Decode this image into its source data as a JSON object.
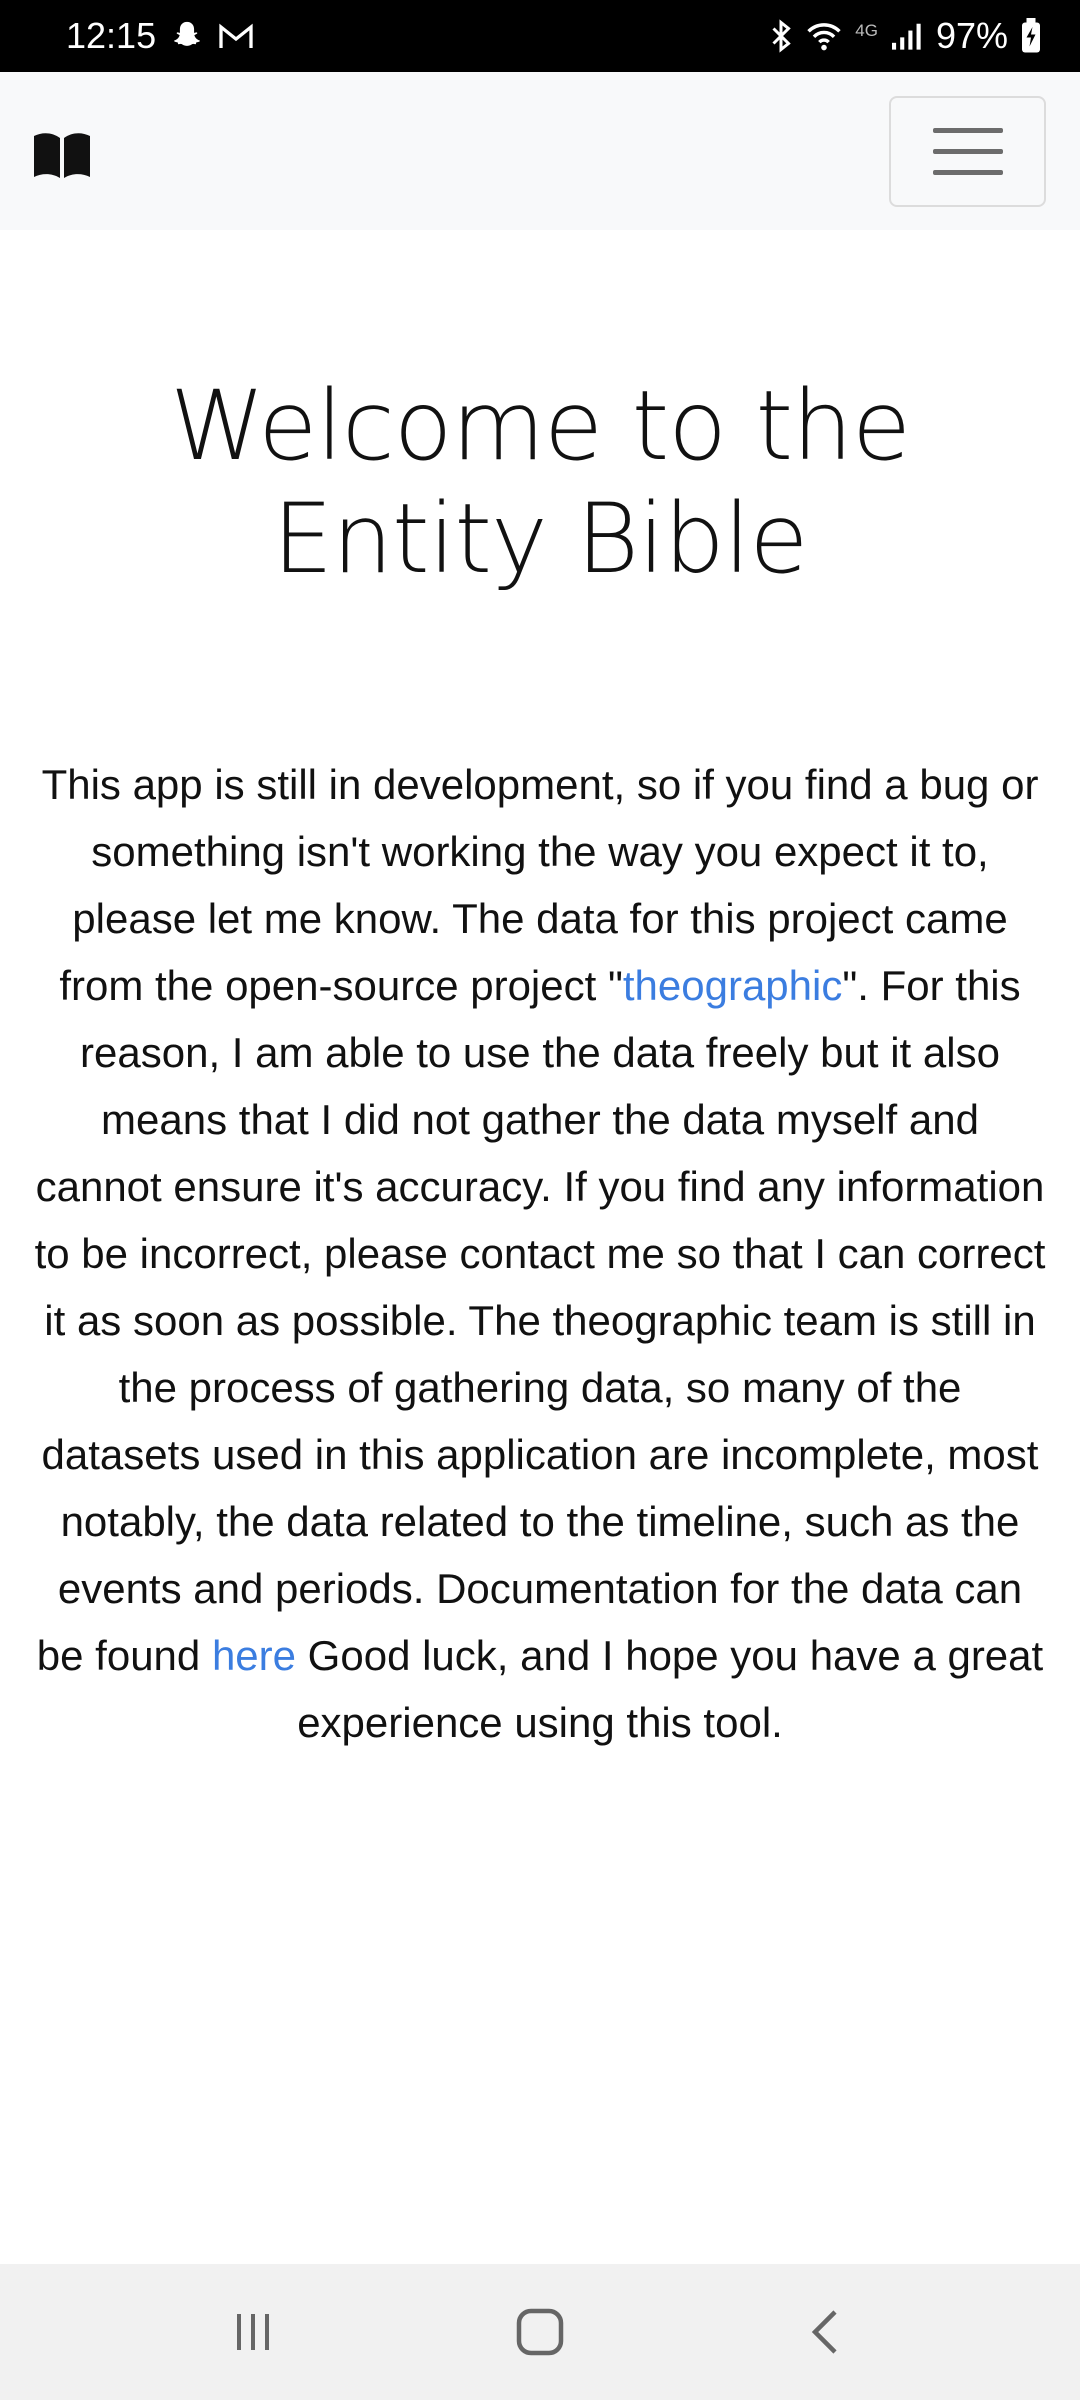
{
  "status_bar": {
    "time": "12:15",
    "battery": "97%",
    "icons": [
      "snapchat-icon",
      "gmail-icon",
      "bluetooth-icon",
      "wifi-icon",
      "lte-icon",
      "signal-icon",
      "battery-charging-icon"
    ],
    "network_label": "4G"
  },
  "navbar": {
    "brand_icon": "book-icon",
    "menu_icon": "hamburger-menu-icon"
  },
  "main": {
    "title": "Welcome to the Entity Bible",
    "intro": {
      "part1": "This app is still in development, so if you find a bug or something isn't working the way you expect it to, please let me know. The data for this project came from the open-source project \"",
      "link1": "theographic",
      "part2": "\". For this reason, I am able to use the data freely but it also means that I did not gather the data myself and cannot ensure it's accuracy. If you find any information to be incorrect, please contact me so that I can correct it as soon as possible. The theographic team is still in the process of gathering data, so many of the datasets used in this application are incomplete, most notably, the data related to the timeline, such as the events and periods. Documentation for the data can be found ",
      "link2": "here",
      "part3": " Good luck, and I hope you have a great experience using this tool."
    }
  },
  "system_nav": {
    "recents_icon": "recents-icon",
    "home_icon": "home-icon",
    "back_icon": "back-icon"
  },
  "colors": {
    "link": "#3b7de0",
    "navbar_bg": "#f8f9fa",
    "status_bg": "#000000"
  }
}
